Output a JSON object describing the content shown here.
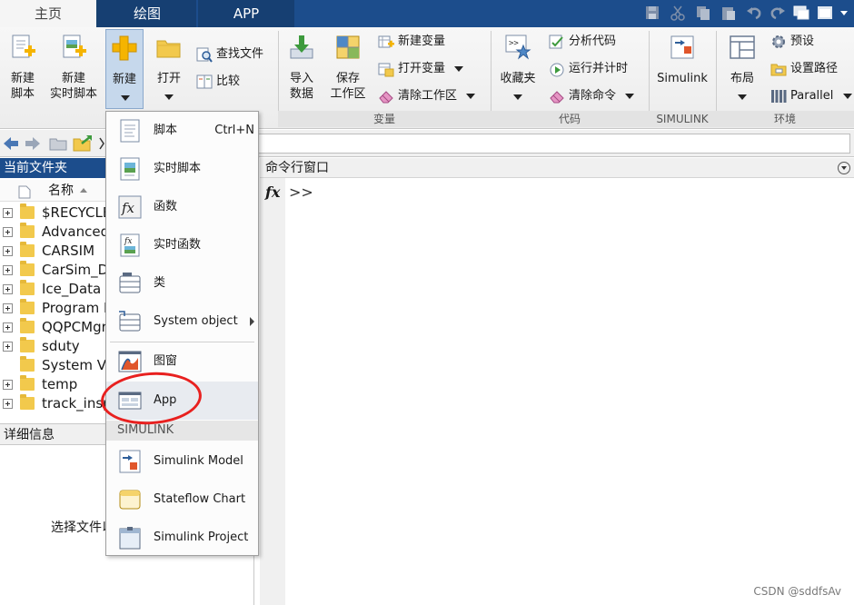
{
  "tabs": [
    {
      "label": "主页",
      "active": true
    },
    {
      "label": "绘图",
      "active": false
    },
    {
      "label": "APP",
      "active": false
    }
  ],
  "quick_access_icons": [
    "save-icon",
    "cut-icon",
    "copy-icon",
    "paste-icon",
    "undo-icon",
    "redo-icon",
    "switch-windows-icon",
    "help-icon"
  ],
  "ribbon": {
    "file": {
      "new_script": "新建\n脚本",
      "new_live_script": "新建\n实时脚本",
      "new": "新建",
      "open": "打开",
      "find_files": "查找文件",
      "compare": "比较"
    },
    "variable": {
      "label": "变量",
      "import_data": "导入\n数据",
      "save_workspace": "保存\n工作区",
      "new_variable": "新建变量",
      "open_variable": "打开变量",
      "clear_workspace": "清除工作区"
    },
    "code": {
      "label": "代码",
      "favorites": "收藏夹",
      "analyze_code": "分析代码",
      "run_and_time": "运行并计时",
      "clear_commands": "清除命令"
    },
    "simulink": {
      "label": "SIMULINK",
      "simulink_button": "Simulink"
    },
    "environment": {
      "label": "环境",
      "layout": "布局",
      "preferences": "预设",
      "set_path": "设置路径",
      "parallel": "Parallel"
    }
  },
  "current_folder": {
    "title": "当前文件夹",
    "column_name": "名称",
    "sort": "ascending",
    "items": [
      {
        "name": "$RECYCLE.BIN",
        "expandable": true
      },
      {
        "name": "AdvancedDriving",
        "expandable": true
      },
      {
        "name": "CARSIM",
        "expandable": true
      },
      {
        "name": "CarSim_Data",
        "expandable": true
      },
      {
        "name": "Ice_Data",
        "expandable": true
      },
      {
        "name": "Program Files",
        "expandable": true
      },
      {
        "name": "QQPCMgr",
        "expandable": true
      },
      {
        "name": "sduty",
        "expandable": true
      },
      {
        "name": "System Volume Information",
        "expandable": false
      },
      {
        "name": "temp",
        "expandable": true
      },
      {
        "name": "track_inspection",
        "expandable": true
      }
    ]
  },
  "details": {
    "title": "详细信息",
    "message": "选择文件以查看详细信息"
  },
  "command_window": {
    "title": "命令行窗口",
    "fx": "fx",
    "prompt": ">>"
  },
  "new_menu": {
    "items": [
      {
        "label": "脚本",
        "shortcut": "Ctrl+N",
        "icon": "script-icon"
      },
      {
        "label": "实时脚本",
        "icon": "live-script-icon"
      },
      {
        "label": "函数",
        "icon": "function-icon"
      },
      {
        "label": "实时函数",
        "icon": "live-function-icon"
      },
      {
        "label": "类",
        "icon": "class-icon"
      },
      {
        "label": "System object",
        "icon": "system-object-icon",
        "submenu": true
      },
      {
        "label": "图窗",
        "icon": "figure-icon"
      },
      {
        "label": "App",
        "icon": "app-icon",
        "highlighted": true
      }
    ],
    "section_label": "SIMULINK",
    "simulink_items": [
      {
        "label": "Simulink Model",
        "icon": "simulink-model-icon"
      },
      {
        "label": "Stateflow Chart",
        "icon": "stateflow-chart-icon"
      },
      {
        "label": "Simulink Project",
        "icon": "simulink-project-icon"
      }
    ]
  },
  "watermark": "CSDN @sddfsAv",
  "colors": {
    "tab_bar": "#1c4d8c",
    "annotation_circle": "#e8201f"
  }
}
